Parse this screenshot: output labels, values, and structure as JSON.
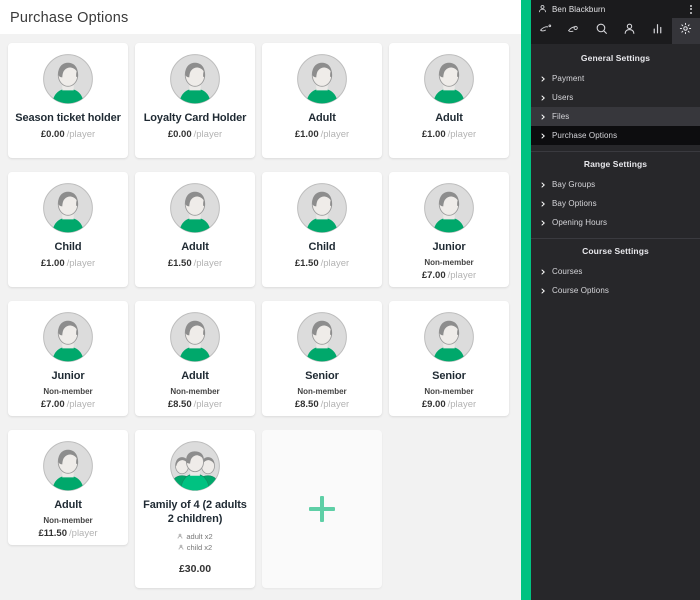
{
  "page": {
    "title": "Purchase Options",
    "accent_color": "#00c281",
    "plus_color": "#5ecfa6",
    "card_bg": "#ffffff",
    "region_bg": "#f2f2f2"
  },
  "cards": [
    {
      "title": "Season ticket holder",
      "sub": "",
      "price": "£0.00",
      "per": "/player",
      "icon": "person-avatar-icon"
    },
    {
      "title": "Loyalty Card Holder",
      "sub": "",
      "price": "£0.00",
      "per": "/player",
      "icon": "person-avatar-icon"
    },
    {
      "title": "Adult",
      "sub": "",
      "price": "£1.00",
      "per": "/player",
      "icon": "person-avatar-icon"
    },
    {
      "title": "Adult",
      "sub": "",
      "price": "£1.00",
      "per": "/player",
      "icon": "person-avatar-icon"
    },
    {
      "title": "Child",
      "sub": "",
      "price": "£1.00",
      "per": "/player",
      "icon": "person-avatar-icon"
    },
    {
      "title": "Adult",
      "sub": "",
      "price": "£1.50",
      "per": "/player",
      "icon": "person-avatar-icon"
    },
    {
      "title": "Child",
      "sub": "",
      "price": "£1.50",
      "per": "/player",
      "icon": "person-avatar-icon"
    },
    {
      "title": "Junior",
      "sub": "Non-member",
      "price": "£7.00",
      "per": "/player",
      "icon": "person-avatar-icon"
    },
    {
      "title": "Junior",
      "sub": "Non-member",
      "price": "£7.00",
      "per": "/player",
      "icon": "person-avatar-icon"
    },
    {
      "title": "Adult",
      "sub": "Non-member",
      "price": "£8.50",
      "per": "/player",
      "icon": "person-avatar-icon"
    },
    {
      "title": "Senior",
      "sub": "Non-member",
      "price": "£8.50",
      "per": "/player",
      "icon": "person-avatar-icon"
    },
    {
      "title": "Senior",
      "sub": "Non-member",
      "price": "£9.00",
      "per": "/player",
      "icon": "person-avatar-icon"
    },
    {
      "title": "Adult",
      "sub": "Non-member",
      "price": "£11.50",
      "per": "/player",
      "icon": "person-avatar-icon"
    },
    {
      "title": "Family of 4 (2 adults 2 children)",
      "sub": "",
      "price": "",
      "per": "",
      "icon": "group-avatar-icon",
      "components": [
        "adult x2",
        "child x2"
      ],
      "total": "£30.00"
    }
  ],
  "add_card": {
    "label": "+",
    "name": "add-purchase-option-card"
  },
  "sidebar": {
    "user": {
      "name": "Ben Blackburn",
      "avatar_icon": "person-icon",
      "menu_icon": "kebab-menu-icon"
    },
    "tabs": [
      {
        "name": "golf-ball-tee-icon",
        "active": false
      },
      {
        "name": "golf-club-icon",
        "active": false
      },
      {
        "name": "search-icon",
        "active": false
      },
      {
        "name": "user-icon",
        "active": false
      },
      {
        "name": "bar-chart-icon",
        "active": false
      },
      {
        "name": "gear-icon",
        "active": true
      }
    ],
    "sections": [
      {
        "title": "General Settings",
        "items": [
          {
            "label": "Payment",
            "state": ""
          },
          {
            "label": "Users",
            "state": ""
          },
          {
            "label": "Files",
            "state": "hover"
          },
          {
            "label": "Purchase Options",
            "state": "active"
          }
        ]
      },
      {
        "title": "Range Settings",
        "items": [
          {
            "label": "Bay Groups",
            "state": ""
          },
          {
            "label": "Bay Options",
            "state": ""
          },
          {
            "label": "Opening Hours",
            "state": ""
          }
        ]
      },
      {
        "title": "Course Settings",
        "items": [
          {
            "label": "Courses",
            "state": ""
          },
          {
            "label": "Course Options",
            "state": ""
          }
        ]
      }
    ]
  }
}
